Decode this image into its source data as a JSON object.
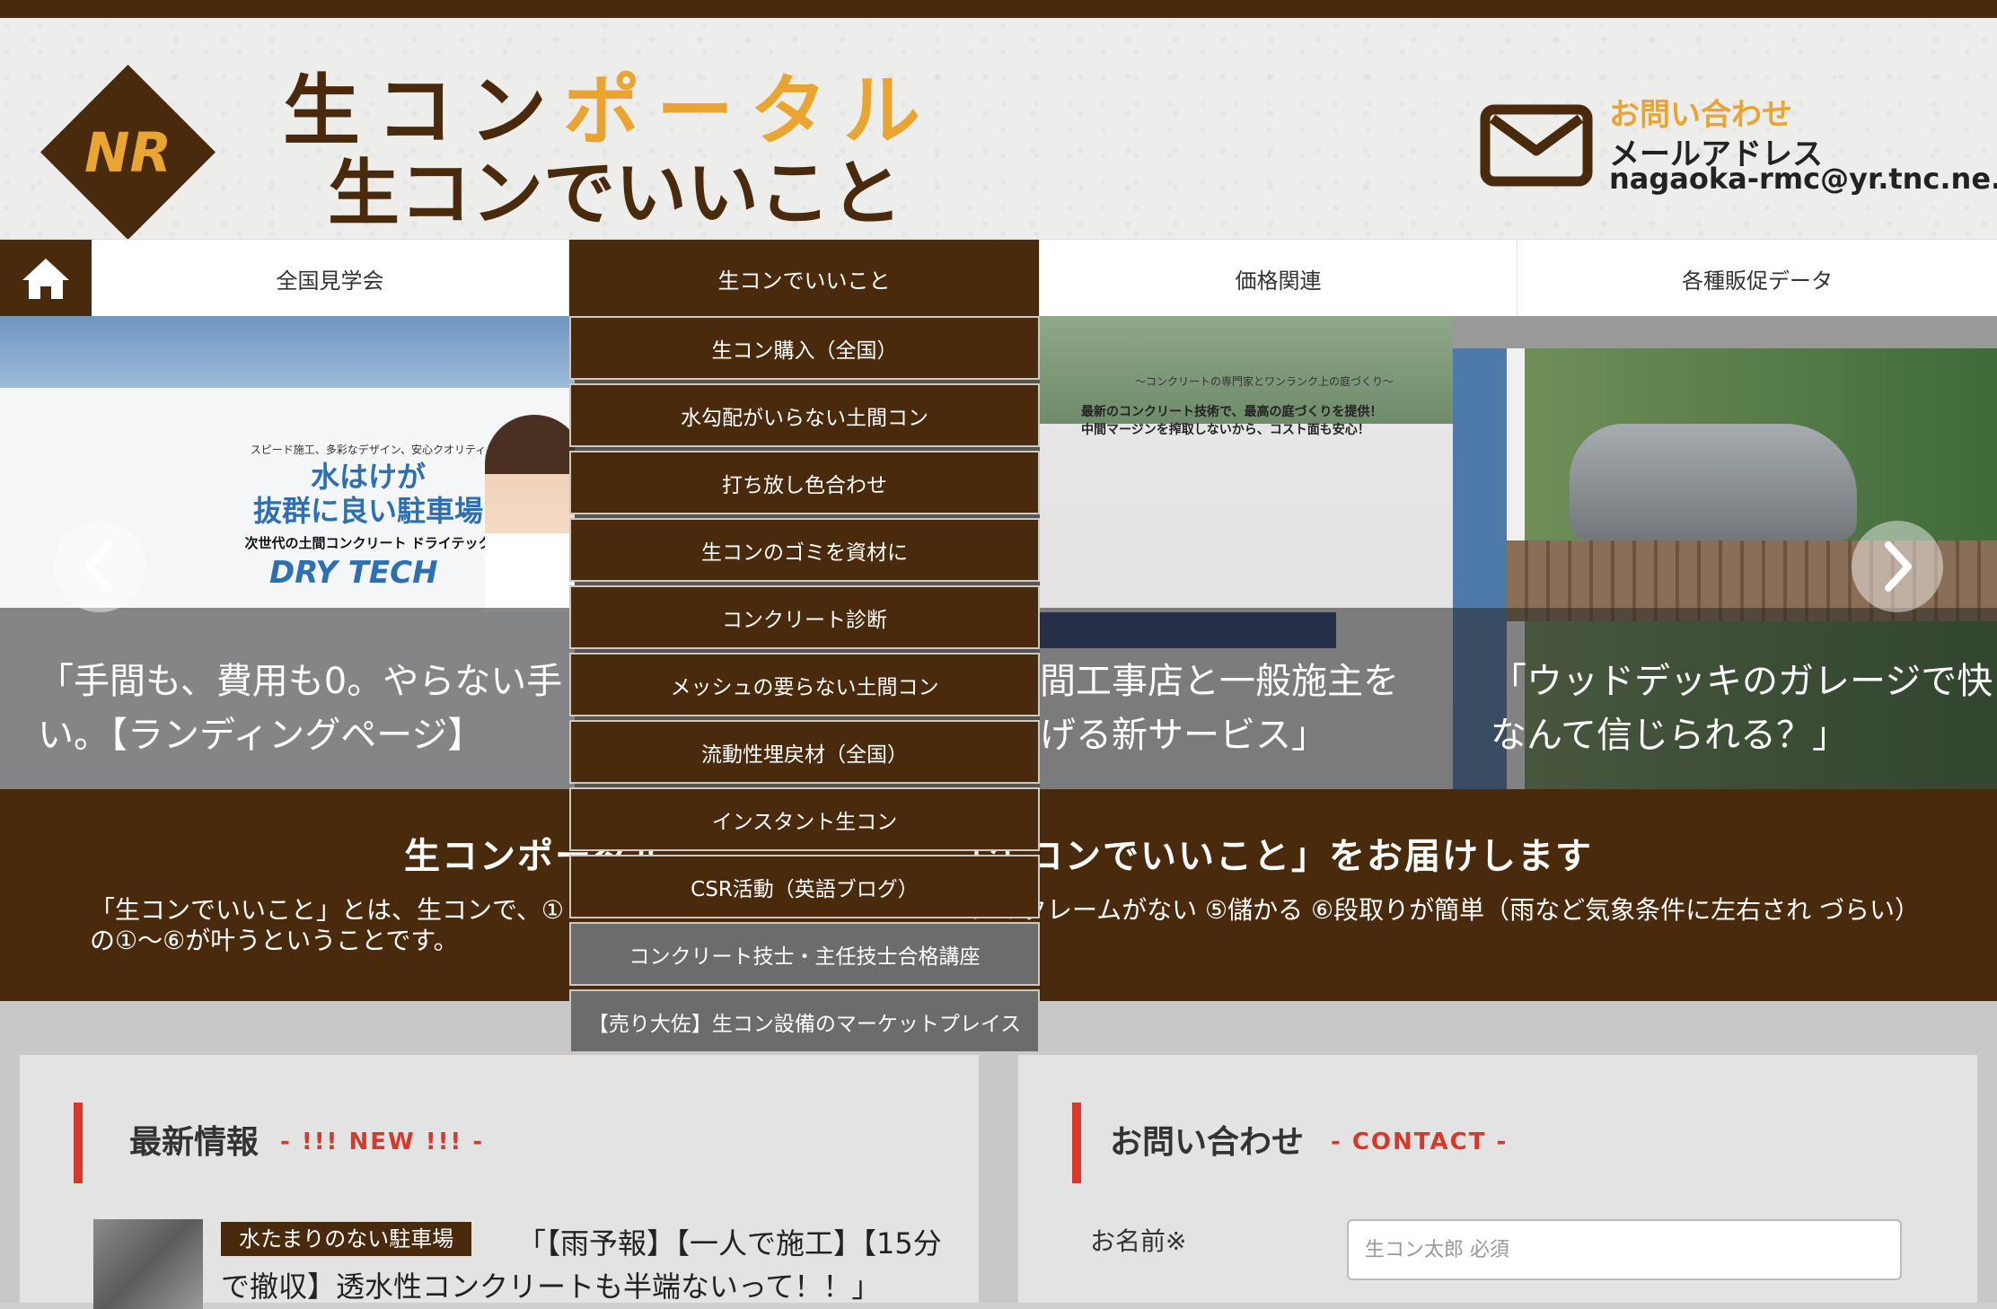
{
  "colors": {
    "brand_brown": "#4a2a0c",
    "accent_orange": "#e9a431",
    "accent_red": "#d6392b"
  },
  "header": {
    "logo_text": "NR",
    "title_line1_a": "生コン",
    "title_line1_b": "ポータル",
    "title_line2": "生コンでいいこと",
    "contact_heading": "お問い合わせ",
    "mail_label": "メールアドレス",
    "mail_address": "nagaoka-rmc@yr.tnc.ne.jp"
  },
  "nav": {
    "home_icon": "home-icon",
    "items": [
      {
        "label": "全国見学会"
      },
      {
        "label": "生コンでいいこと"
      },
      {
        "label": "価格関連"
      },
      {
        "label": "各種販促データ"
      }
    ]
  },
  "dropdown": {
    "items": [
      {
        "label": "生コン購入（全国）"
      },
      {
        "label": "水勾配がいらない土間コン"
      },
      {
        "label": "打ち放し色合わせ"
      },
      {
        "label": "生コンのゴミを資材に"
      },
      {
        "label": "コンクリート診断"
      },
      {
        "label": "メッシュの要らない土間コン"
      },
      {
        "label": "流動性埋戻材（全国）"
      },
      {
        "label": "インスタント生コン"
      },
      {
        "label": "CSR活動（英語ブログ）"
      },
      {
        "label": "コンクリート技士・主任技士合格講座"
      },
      {
        "label": "【売り大佐】生コン設備のマーケットプレイス"
      }
    ]
  },
  "slider": {
    "slides": [
      {
        "caption": "「手間も、費用も0。やらない手\nい。【ランディングページ】",
        "ad_small": "スピード施工、多彩なデザイン、安心クオリティ",
        "ad_headline_1": "水はけが",
        "ad_headline_2": "抜群に良い駐車場",
        "ad_sub": "次世代の土間コンクリート ドライテック",
        "ad_brand": "DRY TECH"
      },
      {
        "caption": "間工事店と一般施主を\nげる新サービス」",
        "banner_small": "〜コンクリートの専門家とワンランク上の庭づくり〜",
        "banner_line1": "最新のコンクリート技術で、最高の庭づくりを提供！",
        "banner_line2": "中間マージンを搾取しないから、コスト面も安心！"
      },
      {
        "caption": "「ウッドデッキのガレージで快\nなんて信じられる？」"
      }
    ],
    "prev_icon": "chevron-left-icon",
    "next_icon": "chevron-right-icon"
  },
  "intro": {
    "title": "生コンポータル　　　　　　　　「生コンでいいこと」をお届けします",
    "text": "「生コンでいいこと」とは、生コンで、①　　　　　　　　　　　　　　　　い ④クレームがない ⑤儲かる ⑥段取りが簡単（雨など気象条件に左右され づらい） の①〜⑥が叶うということです。"
  },
  "news": {
    "title": "最新情報",
    "subtitle": "- !!! NEW !!! -",
    "item_tag": "水たまりのない駐車場",
    "item_title": "「【雨予報】【一人で施工】【15分で撤収】透水性コンクリートも半端ないって！！」"
  },
  "contact": {
    "title": "お問い合わせ",
    "subtitle": "- CONTACT -",
    "name_label": "お名前※",
    "name_placeholder": "生コン太郎 必須"
  }
}
